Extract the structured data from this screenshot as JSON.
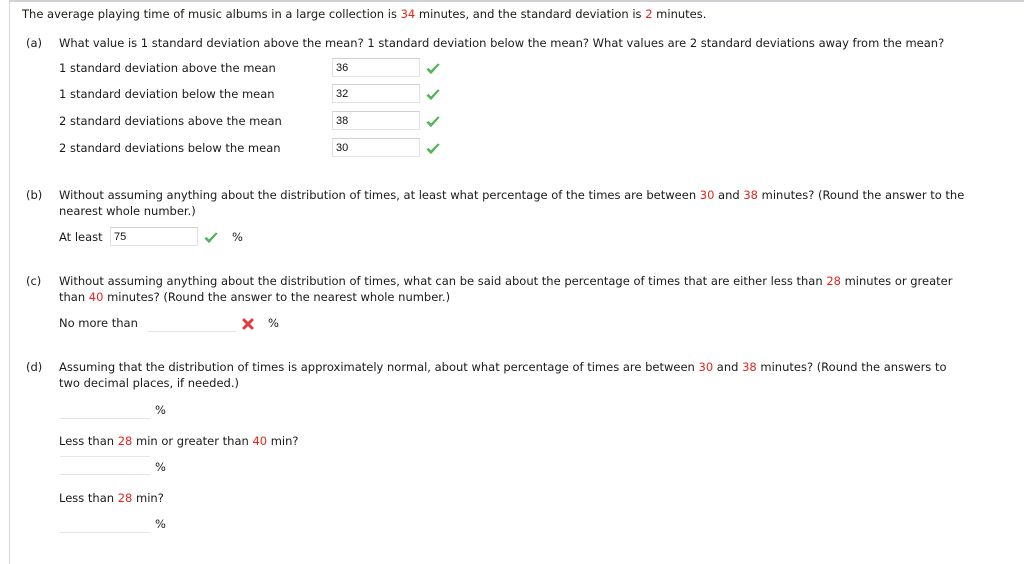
{
  "intro": {
    "pre": "The average playing time of music albums in a large collection is ",
    "mean": "34",
    "mid": " minutes, and the standard deviation is ",
    "sd": "2",
    "post": " minutes."
  },
  "part_a": {
    "label": "(a)",
    "question": "What value is 1 standard deviation above the mean? 1 standard deviation below the mean? What values are 2 standard deviations away from the mean?",
    "rows": [
      {
        "label": "1 standard deviation above the mean",
        "value": "36",
        "status": "correct"
      },
      {
        "label": "1 standard deviation below the mean",
        "value": "32",
        "status": "correct"
      },
      {
        "label": "2 standard deviations above the mean",
        "value": "38",
        "status": "correct"
      },
      {
        "label": "2 standard deviations below the mean",
        "value": "30",
        "status": "correct"
      }
    ]
  },
  "part_b": {
    "label": "(b)",
    "q_pre": "Without assuming anything about the distribution of times, at least what percentage of the times are between ",
    "low": "30",
    "and": " and ",
    "high": "38",
    "q_post": " minutes? (Round the answer to the",
    "q_line2": "nearest whole number.)",
    "prefix": "At least",
    "value": "75",
    "status": "correct",
    "unit": "%"
  },
  "part_c": {
    "label": "(c)",
    "q_pre": "Without assuming anything about the distribution of times, what can be said about the percentage of times that are either less than ",
    "low": "28",
    "q_mid": " minutes or greater",
    "q_line2_pre": "than ",
    "high": "40",
    "q_line2_post": " minutes? (Round the answer to the nearest whole number.)",
    "prefix": "No more than",
    "value": "",
    "status": "incorrect",
    "unit": "%"
  },
  "part_d": {
    "label": "(d)",
    "q_pre": "Assuming that the distribution of times is approximately normal, about what percentage of times are between ",
    "low": "30",
    "and": " and ",
    "high": "38",
    "q_post": " minutes? (Round the answers to",
    "q_line2": "two decimal places, if needed.)",
    "answer1": {
      "value": "",
      "unit": "%"
    },
    "sub2": {
      "pre": "Less than ",
      "a": "28",
      "mid": " min or greater than ",
      "b": "40",
      "post": " min?"
    },
    "answer2": {
      "value": "",
      "unit": "%"
    },
    "sub3": {
      "pre": "Less than ",
      "a": "28",
      "post": " min?"
    },
    "answer3": {
      "value": "",
      "unit": "%"
    }
  },
  "colors": {
    "highlight": "#e0271c",
    "correct": "#5cb85c",
    "incorrect": "#e8383d"
  }
}
